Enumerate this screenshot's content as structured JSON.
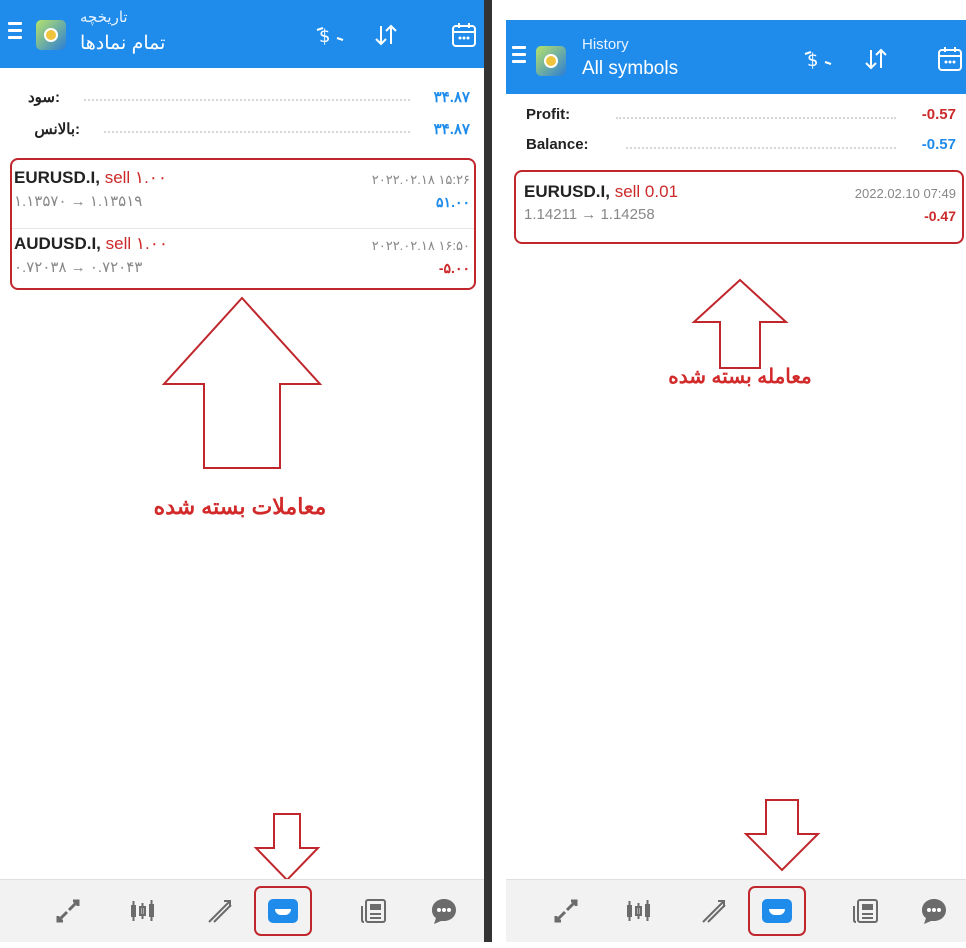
{
  "left": {
    "header": {
      "title": "تاریخچه",
      "subtitle": "تمام نمادها"
    },
    "summary": {
      "profit_label": "سود:",
      "profit_value": "۳۴.۸۷",
      "balance_label": "بالانس:",
      "balance_value": "۳۴.۸۷"
    },
    "trades": [
      {
        "symbol": "EURUSD.I,",
        "side": "sell ۱.۰۰",
        "prices": "۱.۱۳۵۷۰ → ۱.۱۳۵۱۹",
        "time": "۲۰۲۲.۰۲.۱۸ ۱۵:۲۶",
        "pl": "۵۱.۰۰"
      },
      {
        "symbol": "AUDUSD.I,",
        "side": "sell ۱.۰۰",
        "prices": "۰.۷۲۰۳۸ → ۰.۷۲۰۴۳",
        "time": "۲۰۲۲.۰۲.۱۸ ۱۶:۵۰",
        "pl": "-۵.۰۰"
      }
    ],
    "annotation": "معاملات بسته شده"
  },
  "right": {
    "header": {
      "title": "History",
      "subtitle": "All symbols"
    },
    "summary": {
      "profit_label": "Profit:",
      "profit_value": "-0.57",
      "balance_label": "Balance:",
      "balance_value": "-0.57"
    },
    "trades": [
      {
        "symbol": "EURUSD.I,",
        "side": "sell 0.01",
        "prices": "1.14211 → 1.14258",
        "time": "2022.02.10 07:49",
        "pl": "-0.47"
      }
    ],
    "annotation": "معامله بسته شده"
  },
  "colors": {
    "accent": "#1f8ceb",
    "positive": "#1f8ceb",
    "negative": "#cc2a2a",
    "annotation": "#c0272d"
  },
  "toolbar_icons": [
    "currency-exchange-icon",
    "sort-icon",
    "calendar-icon"
  ],
  "nav_icons": [
    "quotes-icon",
    "chart-icon",
    "trade-icon",
    "history-icon",
    "news-icon",
    "chat-icon"
  ]
}
